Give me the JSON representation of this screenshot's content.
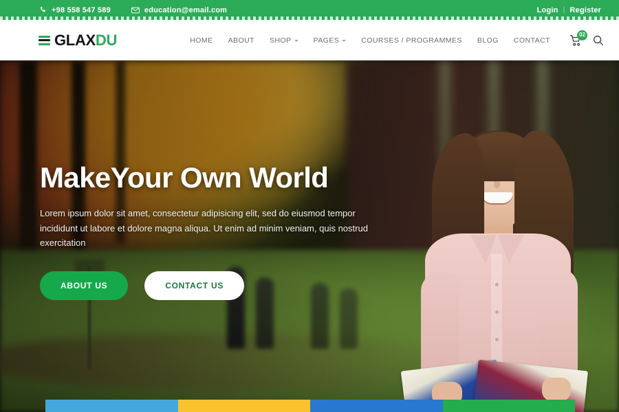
{
  "topbar": {
    "phone": "+98 558 547 589",
    "email": "education@email.com",
    "phone_icon": "phone-icon",
    "email_icon": "envelope-icon",
    "login_label": "Login",
    "separator": "|",
    "register_label": "Register",
    "bg_color": "#2cab58"
  },
  "header": {
    "logo": {
      "text_primary": "GLAX",
      "text_accent": "DU",
      "mark": "hamburger-bars-icon"
    },
    "nav": [
      {
        "label": "HOME",
        "has_dropdown": false
      },
      {
        "label": "ABOUT",
        "has_dropdown": false
      },
      {
        "label": "SHOP",
        "has_dropdown": true
      },
      {
        "label": "PAGES",
        "has_dropdown": true
      },
      {
        "label": "COURSES / PROGRAMMES",
        "has_dropdown": false
      },
      {
        "label": "BLOG",
        "has_dropdown": false
      },
      {
        "label": "CONTACT",
        "has_dropdown": false
      }
    ],
    "cart": {
      "icon": "shopping-cart-icon",
      "badge_count": "02",
      "badge_color": "#2cab58"
    },
    "search": {
      "icon": "search-icon"
    }
  },
  "hero": {
    "title": "MakeYour Own World",
    "paragraph": "Lorem ipsum dolor sit amet, consectetur adipisicing elit, sed do eiusmod tempor incididunt ut labore et dolore magna aliqua. Ut enim ad minim veniam, quis nostrud exercitation",
    "primary_button": "ABOUT US",
    "secondary_button": "CONTACT US",
    "primary_color": "#16a94b",
    "secondary_text_color": "#18763c",
    "image_alt": "Smiling female student holding an open book on an autumn campus"
  },
  "cards": [
    {
      "name": "card-one",
      "color": "#44a8dd"
    },
    {
      "name": "card-two",
      "color": "#fcc22d"
    },
    {
      "name": "card-three",
      "color": "#2878d0"
    },
    {
      "name": "card-four",
      "color": "#24ad4c"
    }
  ]
}
